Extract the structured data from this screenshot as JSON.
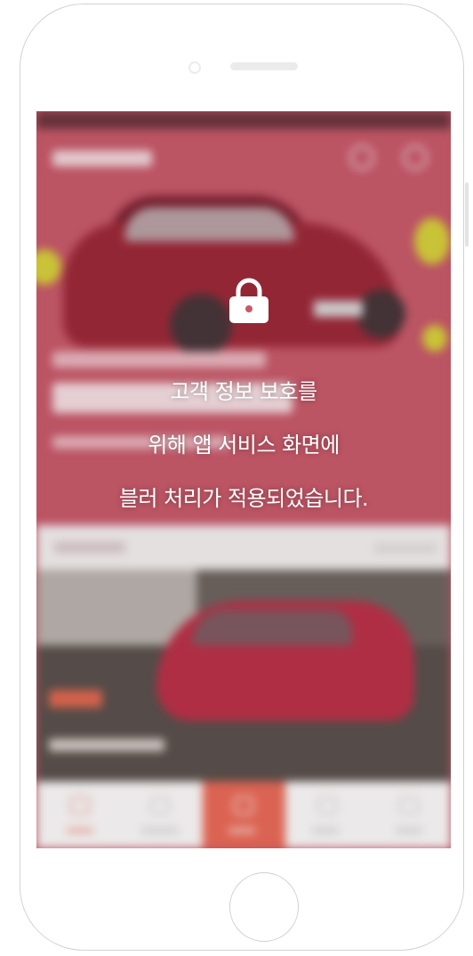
{
  "notice": {
    "line1": "고객 정보 보호를",
    "line2": "위해 앱 서비스 화면에",
    "line3": "블러 처리가 적용되었습니다."
  },
  "icons": {
    "lock": "lock-icon"
  },
  "colors": {
    "hero_background": "#c7596a",
    "tab_highlight": "#ea6a58",
    "notice_text": "#ffffff"
  }
}
